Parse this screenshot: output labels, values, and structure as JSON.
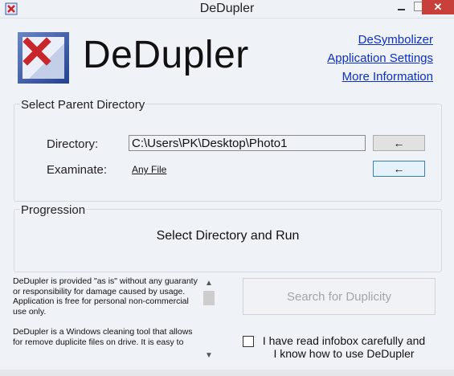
{
  "window": {
    "title": "DeDupler",
    "close_symbol": "✕"
  },
  "header": {
    "brand": "DeDupler",
    "logo_icon": "dedupler-logo-icon",
    "links": [
      "DeSymbolizer",
      "Application Settings",
      "More Information"
    ]
  },
  "parent_directory": {
    "legend": "Select Parent Directory",
    "directory_label": "Directory:",
    "directory_value": "C:\\Users\\PK\\Desktop\\Photo1",
    "examinate_label": "Examinate:",
    "examinate_value": "Any File",
    "browse_symbol": "←",
    "examinate_symbol": "←"
  },
  "progression": {
    "legend": "Progression",
    "status": "Select Directory and Run"
  },
  "infobox": {
    "text": "DeDupler is provided \"as is\" without any guaranty or responsibility for damage caused by usage.\nApplication is free for personal non-commercial use only.\n\nDeDupler is a Windows cleaning tool that allows for remove duplicite files on drive. It is easy to"
  },
  "actions": {
    "search_label": "Search for Duplicity",
    "confirm_label": "I have read infobox carefully and I know how to use DeDupler",
    "confirm_checked": false
  },
  "colors": {
    "link": "#0c2fc9",
    "close_button": "#c8403a",
    "logo_red": "#c8262b",
    "logo_blue": "#3a5da8"
  }
}
